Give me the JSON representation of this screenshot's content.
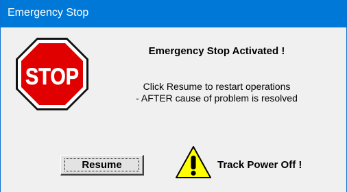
{
  "window": {
    "title": "Emergency Stop"
  },
  "stop_sign": {
    "icon": "stop-sign-icon",
    "text": "STOP",
    "color": "#e00000"
  },
  "message": {
    "heading": "Emergency Stop Activated !",
    "line1": "Click Resume to restart operations",
    "line2": "- AFTER cause of problem is resolved"
  },
  "actions": {
    "resume_label": "Resume"
  },
  "status": {
    "icon": "warning-icon",
    "text": "Track Power Off !",
    "warning_color": "#ffff00"
  },
  "colors": {
    "titlebar": "#0078d7",
    "dialog_bg": "#f0f0f0"
  }
}
